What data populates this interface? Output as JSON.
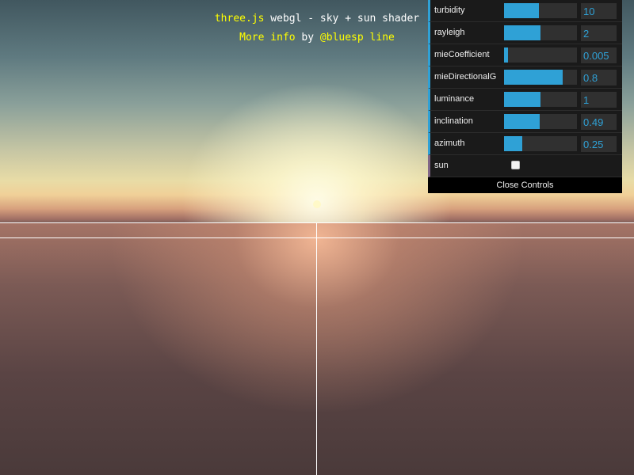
{
  "info": {
    "line1_link": "three.js",
    "line1_text": " webgl - sky + sun shader",
    "line2_link": "More info",
    "line2_by": " by ",
    "line2_author": "@bluesp line"
  },
  "gui": {
    "controls": [
      {
        "label": "turbidity",
        "value": "10",
        "fraction": 0.48
      },
      {
        "label": "rayleigh",
        "value": "2",
        "fraction": 0.5
      },
      {
        "label": "mieCoefficient",
        "value": "0.005",
        "fraction": 0.05
      },
      {
        "label": "mieDirectionalG",
        "value": "0.8",
        "fraction": 0.8
      },
      {
        "label": "luminance",
        "value": "1",
        "fraction": 0.5
      },
      {
        "label": "inclination",
        "value": "0.49",
        "fraction": 0.49
      },
      {
        "label": "azimuth",
        "value": "0.25",
        "fraction": 0.25
      }
    ],
    "sun": {
      "label": "sun",
      "checked": false
    },
    "close_label": "Close Controls"
  },
  "colors": {
    "accent": "#2fa1d6",
    "panel_bg": "#1a1a1a",
    "link": "#ffff00"
  }
}
